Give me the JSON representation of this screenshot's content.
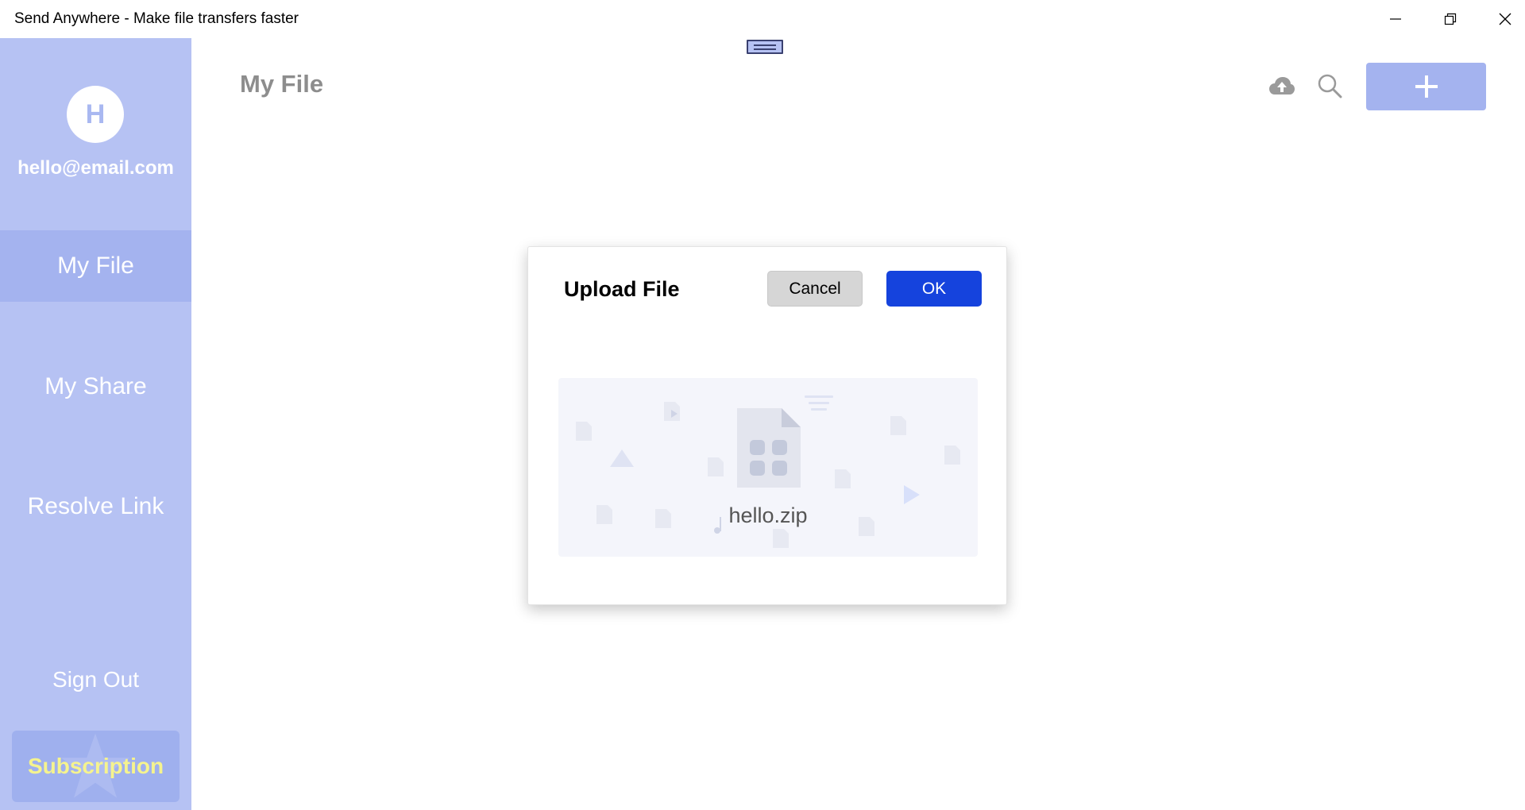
{
  "window": {
    "title": "Send Anywhere - Make file transfers faster",
    "minimize_icon": "minimize-icon",
    "maximize_icon": "restore-icon",
    "close_icon": "close-icon"
  },
  "sidebar": {
    "avatar_initial": "H",
    "email": "hello@email.com",
    "items": [
      {
        "label": "My File",
        "active": true
      },
      {
        "label": "My Share",
        "active": false
      },
      {
        "label": "Resolve Link",
        "active": false
      }
    ],
    "sign_out": "Sign Out",
    "subscription": "Subscription"
  },
  "header": {
    "title": "My File",
    "icons": [
      "cloud-upload-icon",
      "search-icon",
      "plus-icon"
    ]
  },
  "dialog": {
    "title": "Upload File",
    "cancel_label": "Cancel",
    "ok_label": "OK",
    "file_name": "hello.zip",
    "file_icon": "zip-file-icon"
  },
  "colors": {
    "sidebar_bg": "#b6c2f3",
    "sidebar_active": "#a4b3ef",
    "ok_button": "#1543dd",
    "cancel_button": "#d6d6d6",
    "subscription_text": "#f5f38e"
  }
}
